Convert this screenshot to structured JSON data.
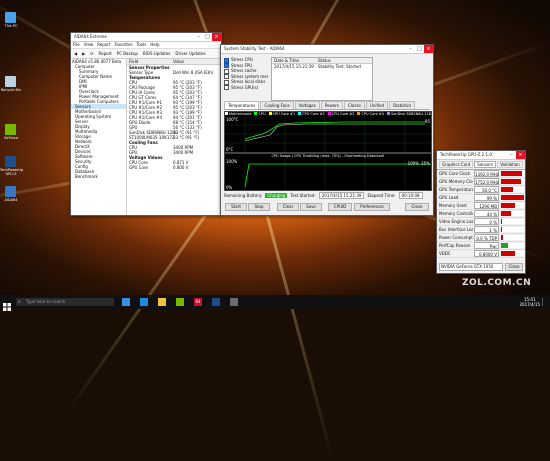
{
  "colors": {
    "accent": "#0078d7",
    "graph_green": "#00ff00",
    "close_red": "#e81123",
    "cpu_bar": "#d00000"
  },
  "aida_main": {
    "title": "AIDA64 Extreme",
    "menu": [
      "File",
      "View",
      "Report",
      "Favorites",
      "Tools",
      "Help"
    ],
    "toolbar": [
      "Report",
      "PC Backup",
      "BIOS Updates",
      "Driver Updates"
    ],
    "tree": [
      "AIDA64 v5.80.4077 Beta",
      "Computer",
      "Summary",
      "Computer Name",
      "DMI",
      "IPMI",
      "Overclock",
      "Power Management",
      "Portable Computers",
      "Sensors",
      "Motherboard",
      "Operating System",
      "Server",
      "Display",
      "Multimedia",
      "Storage",
      "Network",
      "DirectX",
      "Devices",
      "Software",
      "Security",
      "Config",
      "Database",
      "Benchmark"
    ],
    "columns": [
      "Field",
      "Value"
    ],
    "rows": [
      [
        "Sensor Properties",
        ""
      ],
      [
        "Sensor Type",
        "Dell Win 8 (ISA B3h)"
      ],
      [
        "",
        ""
      ],
      [
        "Temperatures",
        ""
      ],
      [
        "CPU",
        "95 °C (203 °F)"
      ],
      [
        "CPU Package",
        "95 °C (203 °F)"
      ],
      [
        "CPU IA Cores",
        "95 °C (203 °F)"
      ],
      [
        "CPU GT Cores",
        "64 °C (147 °F)"
      ],
      [
        "CPU #1/Core #1",
        "93 °C (199 °F)"
      ],
      [
        "CPU #1/Core #2",
        "95 °C (203 °F)"
      ],
      [
        "CPU #1/Core #3",
        "93 °C (199 °F)"
      ],
      [
        "CPU #1/Core #4",
        "94 °C (201 °F)"
      ],
      [
        "GPU Diode",
        "68 °C (154 °F)"
      ],
      [
        "GPU",
        "56 °C (133 °F)"
      ],
      [
        "SanDisk SD8SN8U-128G",
        "33 °C (91 °F)"
      ],
      [
        "ST1000LM035-1RK172",
        "33 °C (91 °F)"
      ],
      [
        "",
        ""
      ],
      [
        "Cooling Fans",
        ""
      ],
      [
        "CPU",
        "3400 RPM"
      ],
      [
        "GPU",
        "3400 RPM"
      ],
      [
        "",
        ""
      ],
      [
        "Voltage Values",
        ""
      ],
      [
        "CPU Core",
        "0.871 V"
      ],
      [
        "GPU Core",
        "0.800 V"
      ]
    ]
  },
  "stability": {
    "title": "System Stability Test - AIDA64",
    "checks": [
      "Stress CPU",
      "Stress FPU",
      "Stress cache",
      "Stress system memory",
      "Stress local disks",
      "Stress GPU(s)"
    ],
    "checks_on": [
      true,
      true,
      false,
      false,
      false,
      false
    ],
    "table_headers": [
      "Date & Time",
      "Status"
    ],
    "table_row": [
      "2017/4/15 15:21:39",
      "Stability Test: Started"
    ],
    "tabs": [
      "Temperatures",
      "Cooling Fans",
      "Voltages",
      "Powers",
      "Clocks",
      "Unified",
      "Statistics"
    ],
    "legend": [
      "Motherboard",
      "CPU",
      "CPU Core #1",
      "CPU Core #2",
      "CPU Core #3",
      "CPU Core #4",
      "SanDisk SD8SN8U-128G"
    ],
    "temp_axis_top": "100°C",
    "temp_axis_bottom": "0°C",
    "temp_value": "95",
    "usage_title": "CPU Usage | CPU Throttling (max: 75%) - Overheating Detected!",
    "usage_axis_top": "100%",
    "usage_axis_bottom": "0%",
    "usage_value_left": "100%",
    "usage_value_right": "25%",
    "status": {
      "battery_label": "Remaining Battery:",
      "battery_value": "Charging",
      "started_label": "Test Started:",
      "started_value": "2017/4/15 15:21:39",
      "elapsed_label": "Elapsed Time:",
      "elapsed_value": "00:10:08"
    },
    "buttons": [
      "Start",
      "Stop",
      "Clear",
      "Save",
      "CPUID",
      "Preferences",
      "Close"
    ]
  },
  "gpuz": {
    "title": "TechPowerUp GPU-Z 2.1.0",
    "tabs": [
      "Graphics Card",
      "Sensors",
      "Validation"
    ],
    "rows": [
      [
        "GPU Core Clock",
        "1392.0 MHz"
      ],
      [
        "GPU Memory Clock",
        "1752.0 MHz"
      ],
      [
        "GPU Temperature",
        "56.0 °C"
      ],
      [
        "GPU Load",
        "99 %"
      ],
      [
        "Memory Used",
        "1290 MB"
      ],
      [
        "Memory Controller Load",
        "44 %"
      ],
      [
        "Video Engine Load",
        "0 %"
      ],
      [
        "Bus Interface Load",
        "1 %"
      ],
      [
        "Power Consumption",
        "0.0 % TDP"
      ],
      [
        "PerfCap Reason",
        "Pwr"
      ],
      [
        "VDDC",
        "0.8000 V"
      ]
    ],
    "bottom_label": "NVIDIA GeForce GTX 1050",
    "close_label": "Close"
  },
  "taskbar": {
    "search_placeholder": "Type here to search",
    "time": "15:41",
    "date": "2017/4/15",
    "badge": "64"
  },
  "desktop_icons": [
    "This PC",
    "Recycle Bin",
    "GeForce",
    "TechPowerUp GPU-Z",
    "AIDA64"
  ],
  "watermark": "ZOL.COM.CN"
}
